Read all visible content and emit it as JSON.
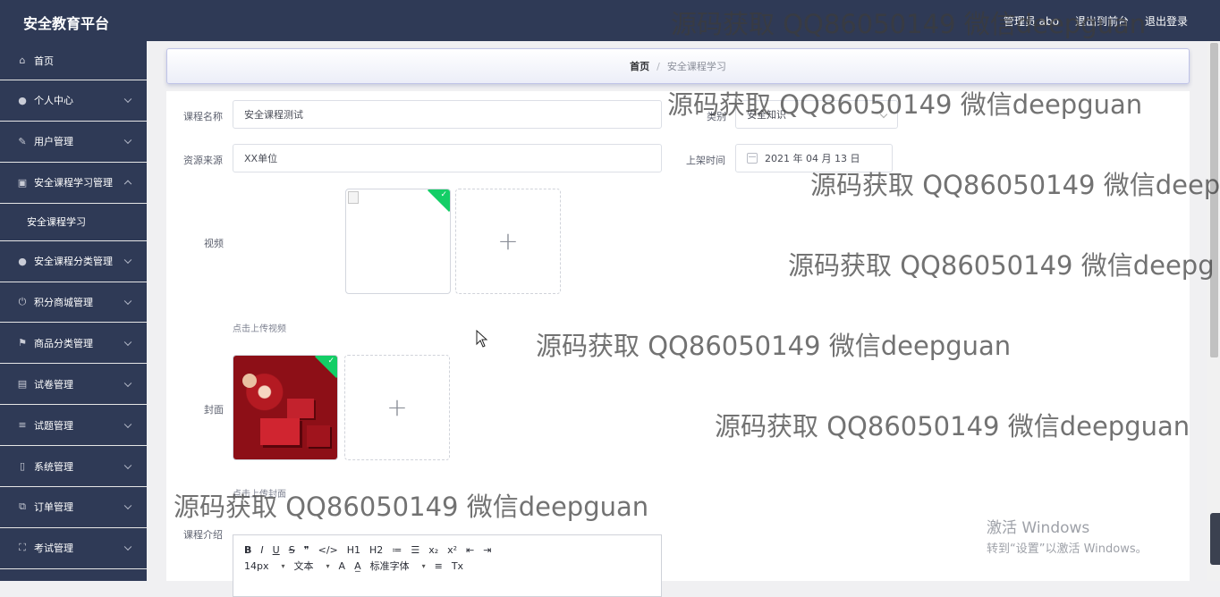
{
  "app": {
    "title": "安全教育平台",
    "top_links": [
      "管理员 abo",
      "退出到前台",
      "退出登录"
    ]
  },
  "sidebar": {
    "items": [
      {
        "label": "首页",
        "icon": "home-icon",
        "expanded": false,
        "has_children": false
      },
      {
        "label": "个人中心",
        "icon": "user-icon",
        "expanded": false,
        "has_children": true
      },
      {
        "label": "用户管理",
        "icon": "edit-icon",
        "expanded": false,
        "has_children": true
      },
      {
        "label": "安全课程学习管理",
        "icon": "clipboard-icon",
        "expanded": true,
        "has_children": true
      },
      {
        "label": "安全课程分类管理",
        "icon": "user-icon",
        "expanded": false,
        "has_children": true
      },
      {
        "label": "积分商城管理",
        "icon": "power-icon",
        "expanded": false,
        "has_children": true
      },
      {
        "label": "商品分类管理",
        "icon": "flag-icon",
        "expanded": false,
        "has_children": true
      },
      {
        "label": "试卷管理",
        "icon": "briefcase-icon",
        "expanded": false,
        "has_children": true
      },
      {
        "label": "试题管理",
        "icon": "list-icon",
        "expanded": false,
        "has_children": true
      },
      {
        "label": "系统管理",
        "icon": "phone-icon",
        "expanded": false,
        "has_children": true
      },
      {
        "label": "订单管理",
        "icon": "copy-icon",
        "expanded": false,
        "has_children": true
      },
      {
        "label": "考试管理",
        "icon": "fullscreen-icon",
        "expanded": false,
        "has_children": true
      }
    ],
    "sub_item": "安全课程学习"
  },
  "breadcrumb": {
    "home": "首页",
    "separator": "/",
    "current": "安全课程学习"
  },
  "form": {
    "course_name_label": "课程名称",
    "course_name_value": "安全课程测试",
    "category_label": "类别",
    "category_value": "安全知识",
    "source_label": "资源来源",
    "source_value": "XX单位",
    "date_label": "上架时间",
    "date_value": "2021 年 04 月 13 日",
    "video_label": "视频",
    "video_hint": "点击上传视频",
    "cover_label": "封面",
    "cover_hint": "点击上传封面",
    "intro_label": "课程介绍"
  },
  "editor": {
    "row1": [
      "B",
      "I",
      "U",
      "S",
      "❞",
      "</>",
      "H1",
      "H2",
      "≔",
      "☰",
      "x₂",
      "x²",
      "⇤",
      "⇥"
    ],
    "font_size": "14px",
    "text_style": "文本",
    "font_family": "标准字体",
    "row2_extra": [
      "A",
      "A̲",
      "≡",
      "Tx"
    ]
  },
  "watermarks": [
    "源码获取 QQ86050149 微信deepguan",
    "源码获取 QQ86050149 微信deepguan",
    "源码获取 QQ86050149 微信deep",
    "源码获取 QQ86050149 微信deepg",
    "源码获取 QQ86050149 微信deepguan",
    "源码获取 QQ86050149 微信deepguan",
    "源码获取 QQ86050149 微信deepguan"
  ],
  "os_notice": {
    "line1": "激活 Windows",
    "line2": "转到“设置”以激活 Windows。"
  },
  "colors": {
    "sidebar_bg": "#2f3a56",
    "success_badge": "#13ce66",
    "panel_bg": "#ffffff"
  }
}
